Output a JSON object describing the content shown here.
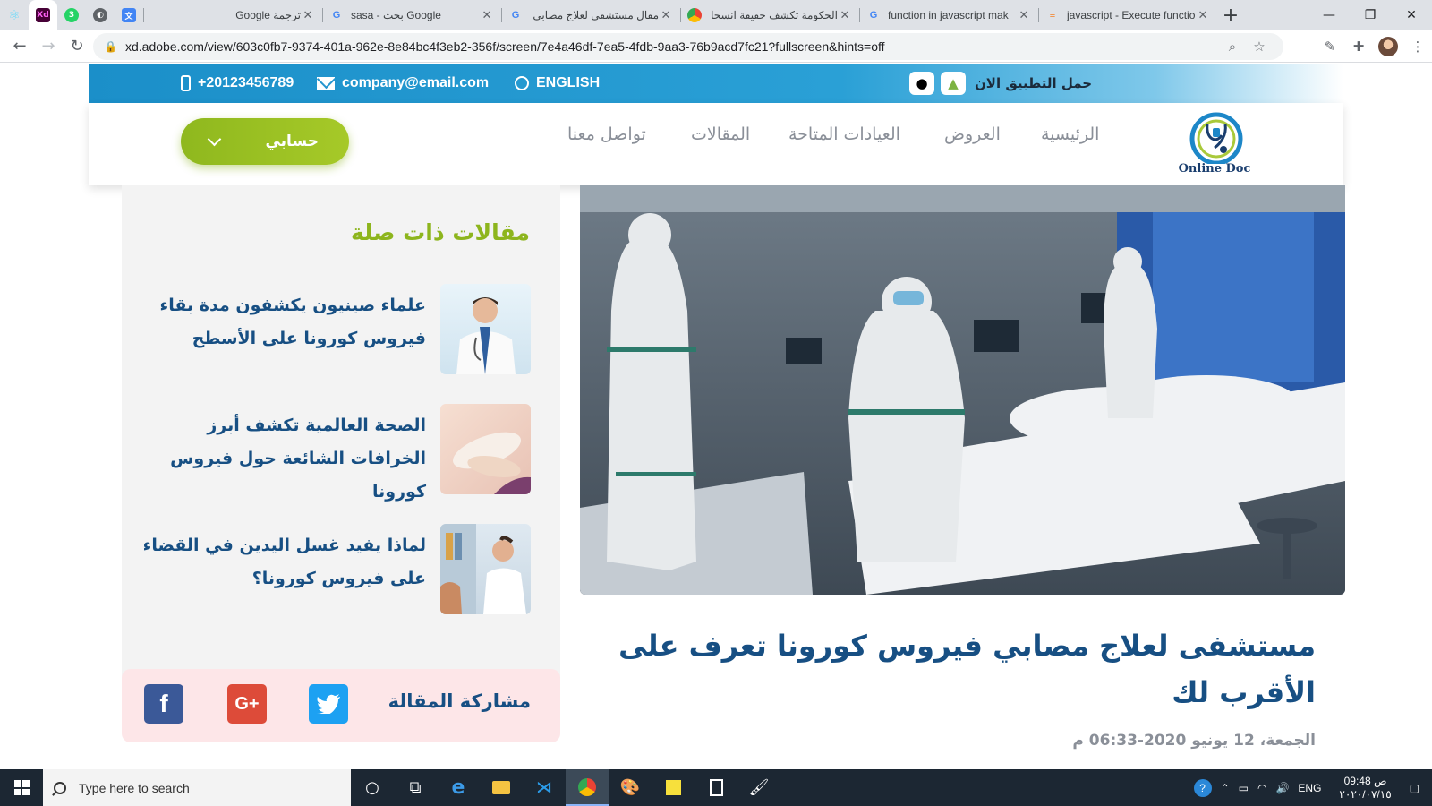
{
  "browser": {
    "tabs": [
      {
        "title": "ترجمة Google",
        "favicon": "google-translate-icon",
        "color": "#4285f4"
      },
      {
        "title": "sasa - بحث Google",
        "favicon": "google-icon",
        "color": "#4285f4"
      },
      {
        "title": "مقال مستشفى لعلاج مصابي",
        "favicon": "google-icon",
        "color": "#4285f4"
      },
      {
        "title": "الحكومة تكشف حقيقة انسحا",
        "favicon": "chrome-icon",
        "color": "#e8710a"
      },
      {
        "title": "function in javascript mak",
        "favicon": "google-icon",
        "color": "#4285f4"
      },
      {
        "title": "javascript - Execute functio",
        "favicon": "stackoverflow-icon",
        "color": "#f48024"
      }
    ],
    "pinned": [
      {
        "name": "react-icon",
        "label": "⚛",
        "color": "#61dafb"
      },
      {
        "name": "adobe-xd-icon",
        "label": "Xd",
        "color": "#470137"
      },
      {
        "name": "whatsapp-icon",
        "label": "3",
        "color": "#25d366"
      },
      {
        "name": "world-icon",
        "label": "◐",
        "color": "#5f6368"
      }
    ],
    "url": "xd.adobe.com/view/603c0fb7-9374-401a-962e-8e84bc4f3eb2-356f/screen/7e4a46df-7ea5-4fdb-9aa3-76b9acd7fc21?fullscreen&hints=off"
  },
  "topbar": {
    "phone": "+20123456789",
    "email": "company@email.com",
    "language": "ENGLISH",
    "app_label": "حمل التطبيق الان"
  },
  "nav": {
    "home": "الرئيسية",
    "offers": "العروض",
    "clinics": "العيادات المتاحة",
    "articles": "المقالات",
    "contact": "تواصل معنا",
    "account": "حسابي"
  },
  "logo": {
    "text": "Online Doc"
  },
  "related": {
    "title": "مقالات ذات صلة",
    "items": [
      {
        "title": "علماء صينيون يكشفون مدة بقاء فيروس كورونا على الأسطح"
      },
      {
        "title": "الصحة العالمية تكشف أبرز الخرافات الشائعة حول فيروس كورونا"
      },
      {
        "title": "لماذا يفيد غسل اليدين في القضاء على فيروس كورونا؟"
      }
    ]
  },
  "share": {
    "label": "مشاركة المقالة",
    "twitter": "twitter-icon",
    "google_plus": "G+",
    "facebook": "f"
  },
  "article": {
    "title": "مستشفى لعلاج مصابي فيروس كورونا تعرف على الأقرب لك",
    "date": "الجمعة، 12 يونيو 2020-06:33 م"
  },
  "taskbar": {
    "search_placeholder": "Type here to search",
    "lang": "ENG",
    "time": "09:48 ص",
    "date": "٢٠٢٠/٠٧/١٥"
  },
  "colors": {
    "brand_blue": "#174f83",
    "topbar_blue": "#1b8fc9",
    "accent_green": "#8db51d",
    "muted_gray": "#8a8f98"
  }
}
